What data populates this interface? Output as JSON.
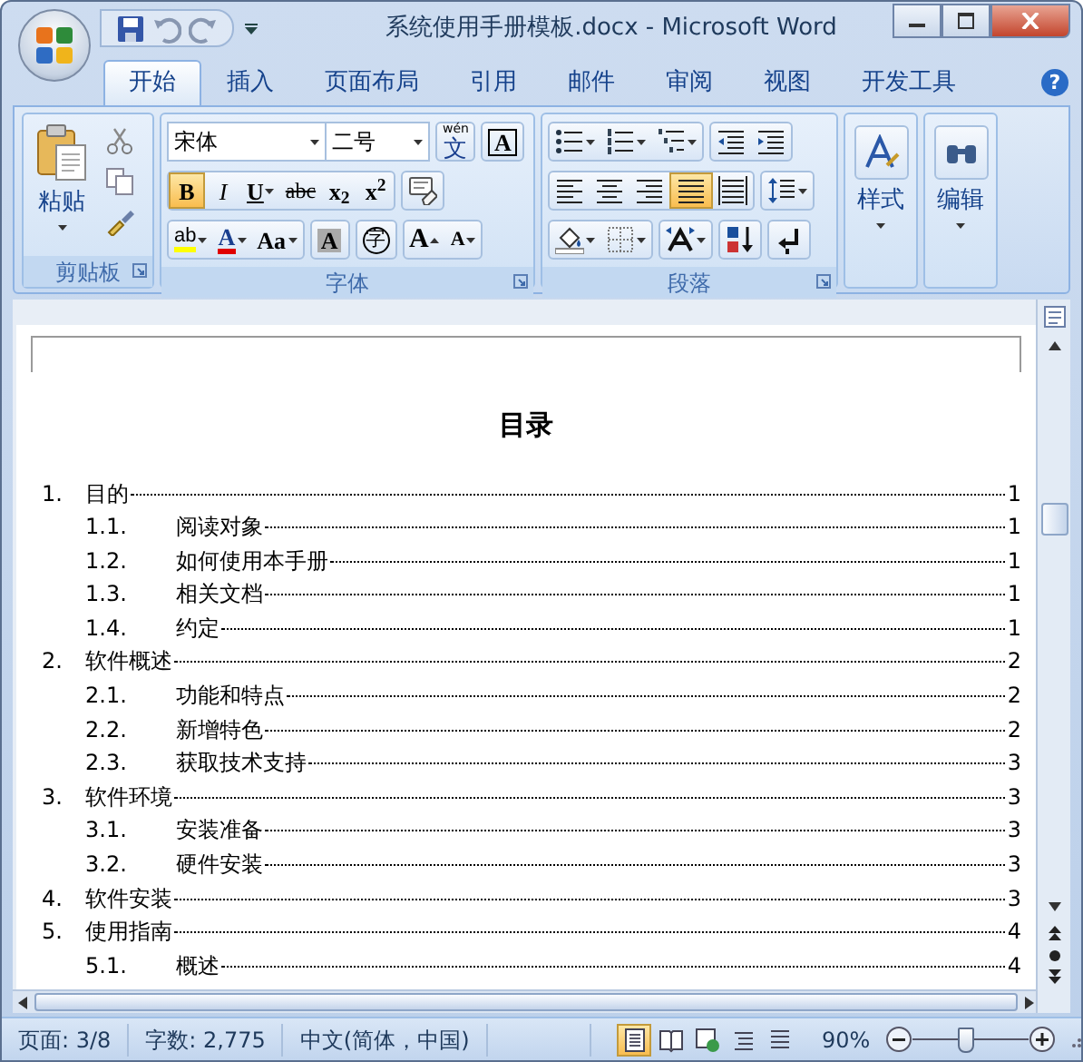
{
  "window": {
    "title": "系统使用手册模板.docx - Microsoft Word"
  },
  "tabs": [
    {
      "label": "开始",
      "selected": true
    },
    {
      "label": "插入",
      "selected": false
    },
    {
      "label": "页面布局",
      "selected": false
    },
    {
      "label": "引用",
      "selected": false
    },
    {
      "label": "邮件",
      "selected": false
    },
    {
      "label": "审阅",
      "selected": false
    },
    {
      "label": "视图",
      "selected": false
    },
    {
      "label": "开发工具",
      "selected": false
    }
  ],
  "help": "?",
  "clipboard": {
    "label": "剪贴板",
    "paste": "粘贴"
  },
  "font": {
    "label": "字体",
    "font_name": "宋体",
    "font_size": "二号",
    "toolbar_rows": [
      {
        "groups": [
          {
            "buttons": [
              {
                "kind": "phonetic",
                "ruby": "wén",
                "text": "文"
              }
            ]
          },
          {
            "buttons": [
              {
                "kind": "boxed",
                "text": "A"
              }
            ]
          }
        ]
      },
      {
        "groups": [
          {
            "buttons": [
              {
                "kind": "bold",
                "text": "B",
                "selected": true
              },
              {
                "kind": "italic",
                "text": "I",
                "selected": false
              },
              {
                "kind": "underline",
                "text": "U",
                "selected": false
              },
              {
                "kind": "strike",
                "text": "abc",
                "selected": false
              },
              {
                "kind": "subscript",
                "text": "x$_{2}$",
                "selected": false
              },
              {
                "kind": "superscript",
                "text": "x$^{2}$",
                "selected": false
              }
            ]
          },
          {
            "buttons": [
              {
                "kind": "clear"
              }
            ]
          }
        ]
      },
      {
        "groups": [
          {
            "buttons": [
              {
                "kind": "highlight",
                "text": "ab"
              },
              {
                "kind": "fontcolor",
                "text": "A"
              },
              {
                "kind": "case",
                "text": "Aa"
              }
            ]
          },
          {
            "buttons": [
              {
                "kind": "shaded",
                "text": "A"
              }
            ]
          },
          {
            "buttons": [
              {
                "kind": "enclosed",
                "text": "字"
              }
            ]
          },
          {
            "buttons": [
              {
                "kind": "grow",
                "text": "A"
              },
              {
                "kind": "shrink",
                "text": "A"
              }
            ]
          }
        ]
      }
    ]
  },
  "paragraph": {
    "label": "段落",
    "toolbar_rows": [
      {
        "groups": [
          {
            "buttons": [
              {
                "kind": "bullets"
              },
              {
                "kind": "numbering"
              },
              {
                "kind": "multilevel"
              }
            ]
          },
          {
            "buttons": [
              {
                "kind": "outdent"
              },
              {
                "kind": "indent"
              }
            ]
          }
        ]
      },
      {
        "groups": [
          {
            "buttons": [
              {
                "kind": "left",
                "selected": false
              },
              {
                "kind": "center",
                "selected": false
              },
              {
                "kind": "right",
                "selected": false
              },
              {
                "kind": "justify",
                "selected": true
              },
              {
                "kind": "distributed",
                "selected": false
              }
            ]
          },
          {
            "buttons": [
              {
                "kind": "spacing"
              }
            ]
          }
        ]
      },
      {
        "groups": [
          {
            "buttons": [
              {
                "kind": "shading"
              },
              {
                "kind": "borders"
              }
            ]
          },
          {
            "buttons": [
              {
                "kind": "layout"
              }
            ]
          },
          {
            "buttons": [
              {
                "kind": "sort"
              }
            ]
          },
          {
            "buttons": [
              {
                "kind": "marks"
              }
            ]
          }
        ]
      }
    ]
  },
  "styles": {
    "label": "样式"
  },
  "editing": {
    "label": "编辑"
  },
  "document": {
    "title": "目录",
    "toc": [
      {
        "number": "1.",
        "title": "目的",
        "page": "1",
        "children": [
          {
            "number": "1.1.",
            "title": "阅读对象",
            "page": "1"
          },
          {
            "number": "1.2.",
            "title": "如何使用本手册",
            "page": "1"
          },
          {
            "number": "1.3.",
            "title": "相关文档",
            "page": "1"
          },
          {
            "number": "1.4.",
            "title": "约定",
            "page": "1"
          }
        ]
      },
      {
        "number": "2.",
        "title": "软件概述",
        "page": "2",
        "children": [
          {
            "number": "2.1.",
            "title": "功能和特点",
            "page": "2"
          },
          {
            "number": "2.2.",
            "title": "新增特色",
            "page": "2"
          },
          {
            "number": "2.3.",
            "title": "获取技术支持",
            "page": "3"
          }
        ]
      },
      {
        "number": "3.",
        "title": "软件环境",
        "page": "3",
        "children": [
          {
            "number": "3.1.",
            "title": "安装准备",
            "page": "3"
          },
          {
            "number": "3.2.",
            "title": "硬件安装",
            "page": "3"
          }
        ]
      },
      {
        "number": "4.",
        "title": "软件安装",
        "page": "3"
      },
      {
        "number": "5.",
        "title": "使用指南",
        "page": "4",
        "children": [
          {
            "number": "5.1.",
            "title": "概述",
            "page": "4"
          }
        ]
      }
    ]
  },
  "status_bar": {
    "page": "页面: 3/8",
    "words": "字数: 2,775",
    "language": "中文(简体，中国)",
    "views": [
      {
        "selected": true
      },
      {
        "selected": false
      },
      {
        "selected": false
      },
      {
        "selected": false
      },
      {
        "selected": false
      }
    ],
    "zoom": "90%",
    "zoom_slider": {
      "level": 0.45
    }
  }
}
